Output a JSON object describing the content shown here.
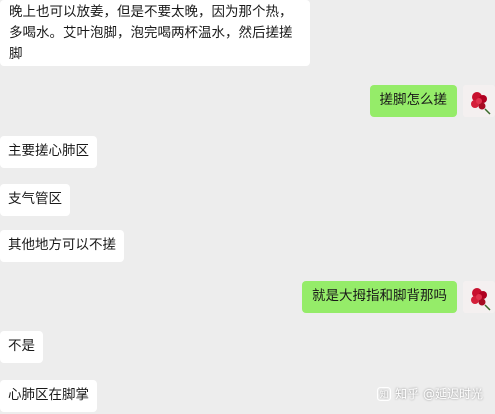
{
  "chat": {
    "messages": [
      {
        "side": "left",
        "lines": [
          "晚上也可以放姜，但是不要太晚，因为那个热，",
          "多喝水。艾叶泡脚，泡完喝两杯温水，然后搓搓",
          "脚"
        ]
      },
      {
        "side": "right",
        "text": "搓脚怎么搓"
      },
      {
        "side": "left",
        "text": "主要搓心肺区"
      },
      {
        "side": "left",
        "text": "支气管区"
      },
      {
        "side": "left",
        "text": "其他地方可以不搓"
      },
      {
        "side": "right",
        "text": "就是大拇指和脚背那吗"
      },
      {
        "side": "left",
        "text": "不是"
      },
      {
        "side": "left",
        "text": "心肺区在脚掌"
      }
    ]
  },
  "watermark": {
    "text": "知乎 @延迟时光",
    "icon": "zhihu-logo-icon"
  },
  "colors": {
    "background": "#ededed",
    "incoming_bubble": "#ffffff",
    "outgoing_bubble": "#95ec69",
    "text": "#191919"
  }
}
